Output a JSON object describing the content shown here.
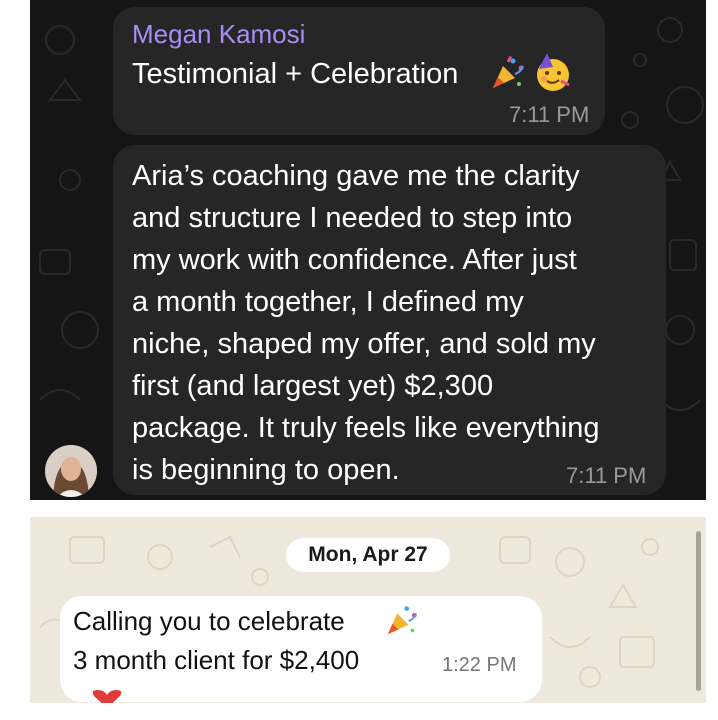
{
  "chat_top": {
    "sender_name": "Megan Kamosi",
    "message1": {
      "text": "Testimonial + Celebration",
      "emojis": [
        "party-popper-icon",
        "partying-face-icon"
      ],
      "time": "7:11 PM"
    },
    "message2": {
      "lines": [
        "Aria’s coaching gave me the clarity",
        "and structure I needed to step into",
        "my work with confidence. After just",
        "a month together, I defined my",
        "niche, shaped my offer, and sold my",
        "first (and largest yet) $2,300",
        "package. It truly feels like everything",
        "is beginning to open."
      ],
      "time": "7:11 PM"
    }
  },
  "chat_bottom": {
    "date_label": "Mon, Apr 27",
    "message": {
      "line1": "Calling you to celebrate",
      "line2": "3 month client for $2,400",
      "emoji": "party-popper-icon",
      "time": "1:22 PM",
      "reaction": "heart-icon"
    }
  },
  "colors": {
    "dark_bg": "#151515",
    "dark_bubble": "#262626",
    "sender_name": "#a98df5",
    "light_bg": "#efe8dc",
    "light_bubble": "#ffffff"
  }
}
